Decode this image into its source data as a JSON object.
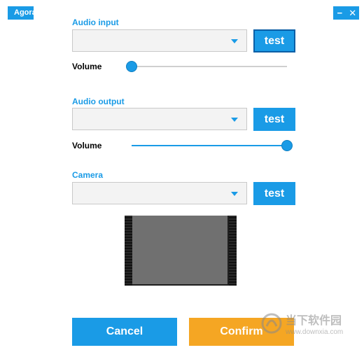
{
  "window": {
    "app_tab": "Agora",
    "minimize_label": "−",
    "close_label": "✕"
  },
  "audio_input": {
    "label": "Audio input",
    "selected": "",
    "test_label": "test",
    "volume_label": "Volume",
    "volume_level": 0
  },
  "audio_output": {
    "label": "Audio output",
    "selected": "",
    "test_label": "test",
    "volume_label": "Volume",
    "volume_level": 1
  },
  "camera": {
    "label": "Camera",
    "selected": "",
    "test_label": "test"
  },
  "footer": {
    "cancel_label": "Cancel",
    "confirm_label": "Confirm"
  },
  "watermark": {
    "name": "当下软件园",
    "url": "www.downxia.com"
  },
  "colors": {
    "accent": "#1a9be6",
    "confirm": "#f5a623",
    "preview": "#707070"
  }
}
